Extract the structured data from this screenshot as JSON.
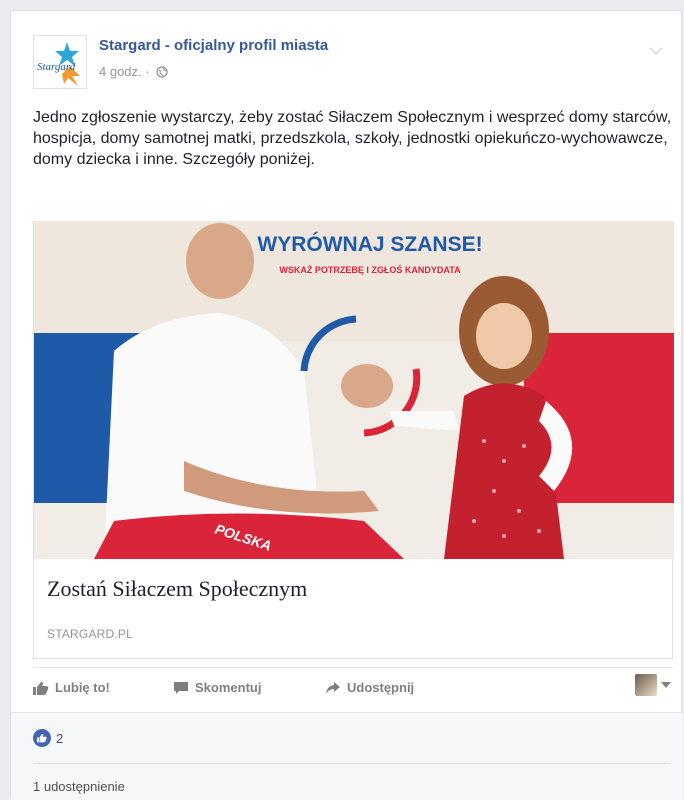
{
  "post": {
    "author": "Stargard - oficjalny profil miasta",
    "time": "4 godz.",
    "separator": "·",
    "text": "Jedno zgłoszenie wystarczy, żeby zostać Siłaczem Społecznym i wesprzeć domy starców, hospicja, domy samotnej matki, przedszkola, szkoły, jednostki opiekuńczo-wychowawcze, domy dziecka i inne. Szczegóły poniżej.",
    "avatar_text": "Stargard",
    "privacy_icon": "globe-icon"
  },
  "link": {
    "banner_title": "WYRÓWNAJ SZANSE!",
    "banner_subtitle": "WSKAŻ POTRZEBĘ I ZGŁOŚ KANDYDATA",
    "shirt_text": "POLSKA",
    "title": "Zostań Siłaczem Społecznym",
    "domain": "STARGARD.PL"
  },
  "actions": {
    "like": "Lubię to!",
    "comment": "Skomentuj",
    "share": "Udostępnij"
  },
  "stats": {
    "likes": "2",
    "shares": "1 udostępnienie"
  },
  "colors": {
    "link_blue": "#365899",
    "like_blue": "#4267b2",
    "banner_blue": "#1f5aa8",
    "banner_red": "#d9243a"
  }
}
